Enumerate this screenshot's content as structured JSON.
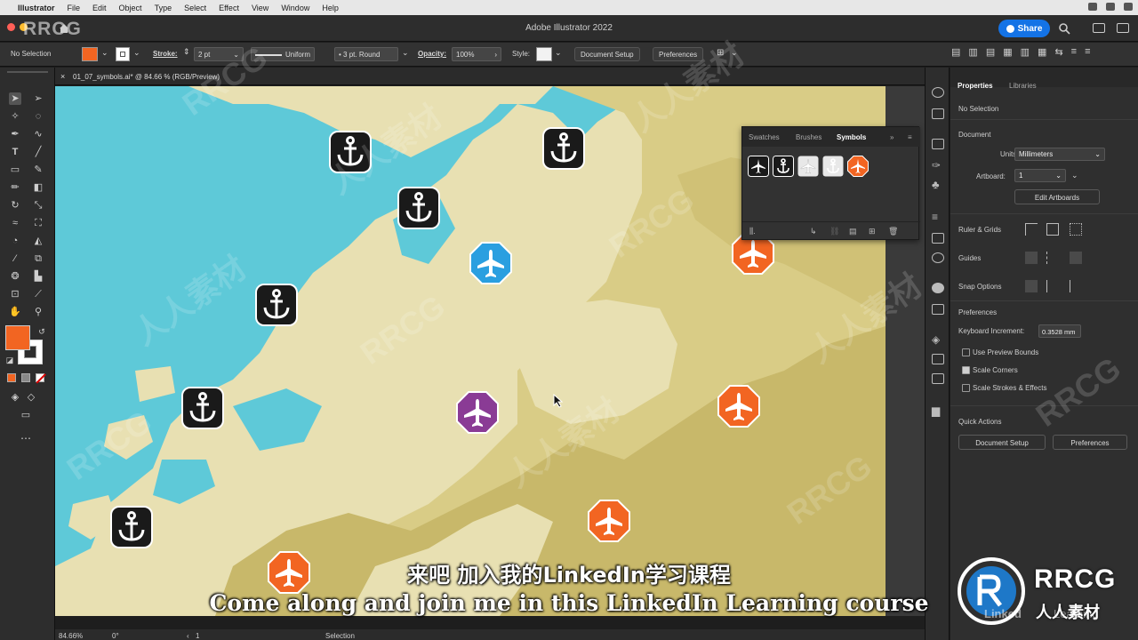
{
  "menubar": {
    "items": [
      "Illustrator",
      "File",
      "Edit",
      "Object",
      "Type",
      "Select",
      "Effect",
      "View",
      "Window",
      "Help"
    ]
  },
  "app": {
    "title": "Adobe Illustrator 2022",
    "share_label": "Share",
    "watermark_top": "RRCG"
  },
  "control_bar": {
    "selection": "No Selection",
    "stroke_label": "Stroke:",
    "stroke_weight": "2 pt",
    "stroke_profile": "Uniform",
    "brush": "3 pt. Round",
    "opacity_label": "Opacity:",
    "opacity": "100%",
    "style_label": "Style:",
    "document_setup": "Document Setup",
    "preferences": "Preferences"
  },
  "doc_tab": {
    "label": "01_07_symbols.ai* @ 84.66 % (RGB/Preview)",
    "close": "×"
  },
  "status_bar": {
    "zoom": "84.66%",
    "rotation": "0°",
    "artboard": "1",
    "tool": "Selection"
  },
  "symbols_panel": {
    "tabs": [
      "Swatches",
      "Brushes",
      "Symbols"
    ],
    "active_tab": "Symbols",
    "menu_icon": "≡",
    "collapse_icon": "»"
  },
  "properties_panel": {
    "tabs": [
      "Properties",
      "Libraries"
    ],
    "selection": "No Selection",
    "document_heading": "Document",
    "units_label": "Units:",
    "units_value": "Millimeters",
    "artboard_label": "Artboard:",
    "artboard_value": "1",
    "edit_artboards": "Edit Artboards",
    "ruler_grids": "Ruler & Grids",
    "guides": "Guides",
    "snap_options": "Snap Options",
    "preferences_heading": "Preferences",
    "keyboard_increment_label": "Keyboard Increment:",
    "keyboard_increment_value": "0.3528 mm",
    "checkboxes": [
      {
        "label": "Use Preview Bounds",
        "checked": false
      },
      {
        "label": "Scale Corners",
        "checked": true
      },
      {
        "label": "Scale Strokes & Effects",
        "checked": false
      }
    ],
    "quick_actions_heading": "Quick Actions",
    "document_setup": "Document Setup",
    "preferences_button": "Preferences"
  },
  "subtitles": {
    "chinese": "来吧 加入我的LinkedIn学习课程",
    "english": "Come along and join me in this LinkedIn Learning course"
  },
  "watermarks": {
    "rrcg": "RRCG",
    "cn_brand": "人人素材",
    "linkedin": "Linked",
    "learning": "Learning"
  },
  "colors": {
    "water": "#5ec9d8",
    "land_light": "#e8e0b2",
    "land_mid": "#d9cc86",
    "land_dark": "#c8b86a",
    "orange": "#f26522",
    "blue": "#2a9fe0",
    "purple": "#8a3b95",
    "black": "#1a1a1a"
  },
  "markers": [
    {
      "icon": "anchor-icon",
      "color": "black"
    },
    {
      "icon": "anchor-icon",
      "color": "black"
    },
    {
      "icon": "anchor-icon",
      "color": "black"
    },
    {
      "icon": "anchor-icon",
      "color": "black"
    },
    {
      "icon": "anchor-icon",
      "color": "black"
    },
    {
      "icon": "anchor-icon",
      "color": "black"
    },
    {
      "icon": "airplane-icon",
      "color": "blue"
    },
    {
      "icon": "airplane-icon",
      "color": "purple"
    },
    {
      "icon": "airplane-icon",
      "color": "orange"
    },
    {
      "icon": "airplane-icon",
      "color": "orange"
    },
    {
      "icon": "airplane-icon",
      "color": "orange"
    },
    {
      "icon": "airplane-icon",
      "color": "orange"
    }
  ]
}
